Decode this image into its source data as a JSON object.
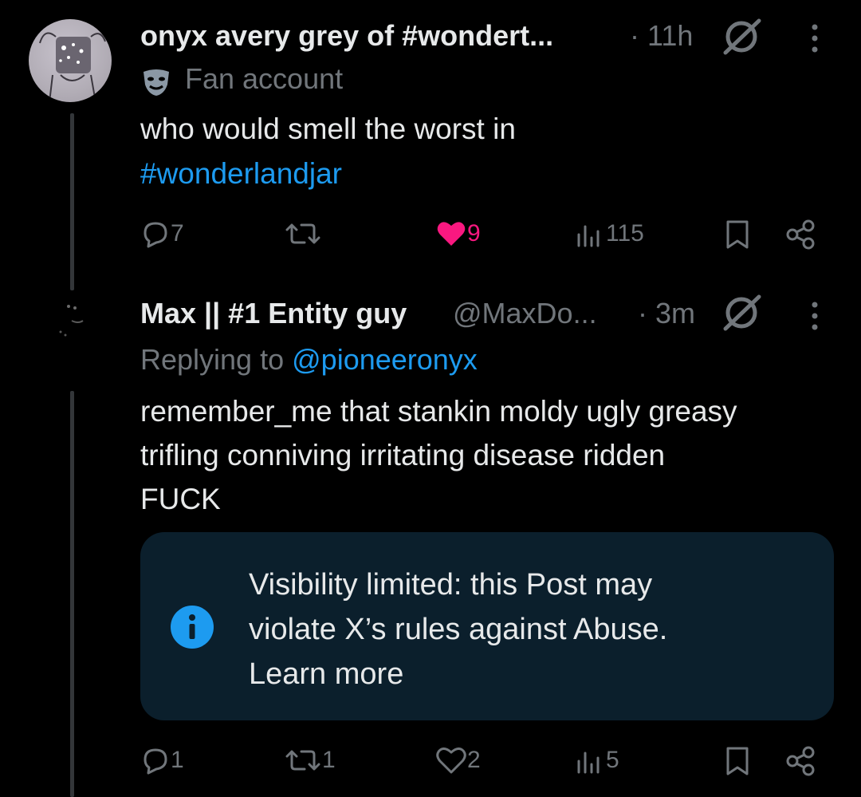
{
  "colors": {
    "background": "#000000",
    "accent": "#1d9bf0",
    "like_active": "#f91880",
    "muted": "#71767b",
    "notice_bg": "#0b1f2c"
  },
  "post1": {
    "display_name": "onyx avery grey of #wondert...",
    "time": "· 11h",
    "label": "Fan account",
    "text": "who would smell the worst in",
    "hashtag": "#wonderlandjar",
    "replies": "7",
    "likes": "9",
    "views": "115"
  },
  "post2": {
    "display_name": "Max || #1 Entity guy",
    "handle": "@MaxDo...",
    "time": "· 3m",
    "replying_prefix": "Replying to",
    "replying_handle": "@pioneeronyx",
    "text_line1": "remember_me that stankin moldy ugly greasy",
    "text_line2": "trifling conniving irritating disease ridden",
    "text_line3": "FUCK",
    "notice_line1": "Visibility limited: this Post may",
    "notice_line2": "violate X’s rules against Abuse.",
    "notice_link": "Learn more",
    "replies": "1",
    "reposts": "1",
    "likes": "2",
    "views": "5"
  },
  "icons": [
    "grok-icon",
    "more-icon",
    "fan-account-icon",
    "reply-icon",
    "repost-icon",
    "like-icon",
    "views-icon",
    "bookmark-icon",
    "share-icon",
    "info-icon"
  ]
}
